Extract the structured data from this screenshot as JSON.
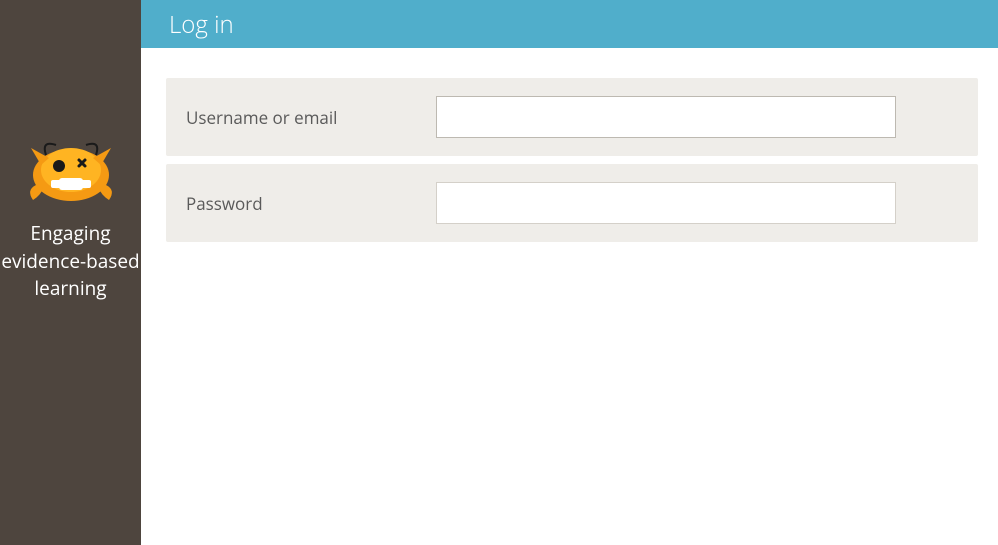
{
  "sidebar": {
    "tagline": "Engaging evidence-based learning"
  },
  "header": {
    "title": "Log in"
  },
  "form": {
    "username": {
      "label": "Username or email",
      "value": "",
      "placeholder": ""
    },
    "password": {
      "label": "Password",
      "value": "",
      "placeholder": ""
    }
  },
  "colors": {
    "sidebar_bg": "#4e453e",
    "header_bg": "#50aecb",
    "row_bg": "#efede9"
  }
}
